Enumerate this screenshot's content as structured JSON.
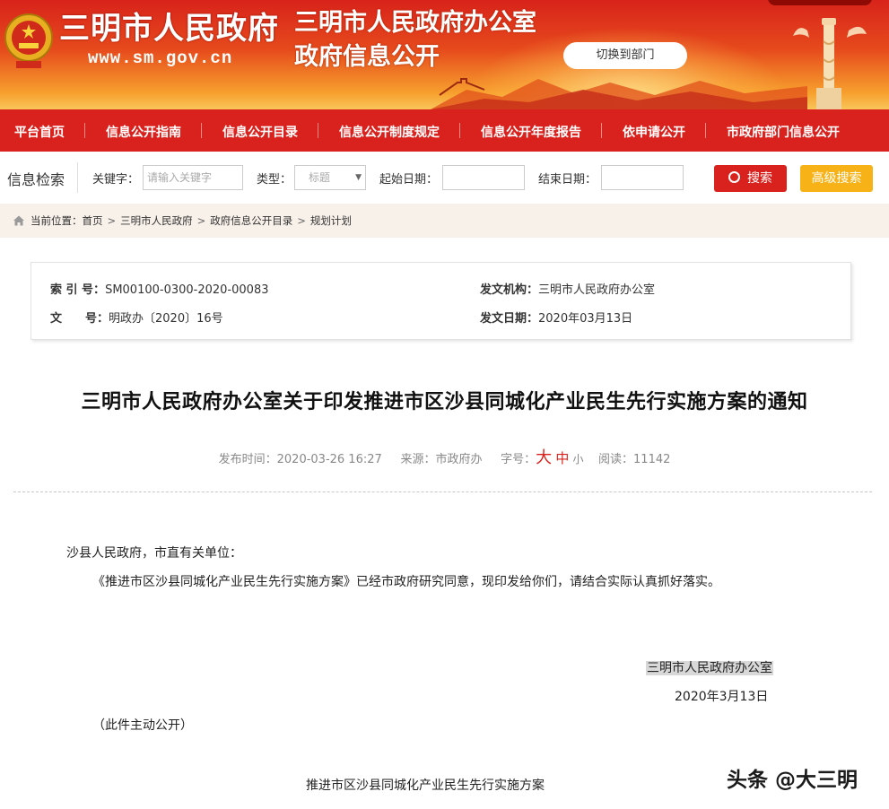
{
  "banner": {
    "site_name": "三明市人民政府",
    "site_url": "www.sm.gov.cn",
    "office_title": "三明市人民政府办公室",
    "office_subtitle": "政府信息公开",
    "switch_button": "切换到部门"
  },
  "nav": {
    "items": [
      "平台首页",
      "信息公开指南",
      "信息公开目录",
      "信息公开制度规定",
      "信息公开年度报告",
      "依申请公开",
      "市政府部门信息公开"
    ]
  },
  "search": {
    "title": "信息检索",
    "keyword_label": "关键字：",
    "keyword_placeholder": "请输入关键字",
    "type_label": "类型：",
    "type_value": "标题",
    "start_label": "起始日期：",
    "end_label": "结束日期：",
    "search_button": "搜索",
    "advanced_button": "高级搜索"
  },
  "breadcrumb": {
    "prefix": "当前位置：",
    "items": [
      "首页",
      "三明市人民政府",
      "政府信息公开目录",
      "规划计划"
    ]
  },
  "meta": {
    "index_label": "索 引 号：",
    "index_value": "SM00100-0300-2020-00083",
    "issuer_label": "发文机构：",
    "issuer_value": "三明市人民政府办公室",
    "docno_label": "文　　号：",
    "docno_value": "明政办〔2020〕16号",
    "date_label": "发文日期：",
    "date_value": "2020年03月13日"
  },
  "document": {
    "title": "三明市人民政府办公室关于印发推进市区沙县同城化产业民生先行实施方案的通知",
    "publish_label": "发布时间：",
    "publish_time": "2020-03-26 16:27",
    "source_label": "来源：",
    "source_value": "市政府办",
    "fontsize_label": "字号：",
    "fontsize_big": "大",
    "fontsize_mid": "中",
    "fontsize_small": "小",
    "views_label": "阅读：",
    "views_value": "11142",
    "salutation": "沙县人民政府，市直有关单位：",
    "paragraph": "《推进市区沙县同城化产业民生先行实施方案》已经市政府研究同意，现印发给你们，请结合实际认真抓好落实。",
    "signature_office": "三明市人民政府办公室",
    "signature_date": "2020年3月13日",
    "disclosure_note": "（此件主动公开）",
    "attachment_title": "推进市区沙县同城化产业民生先行实施方案"
  },
  "watermark": "头条 @大三明",
  "colors": {
    "brand_red": "#d9221d",
    "search_button": "#d9221d",
    "advanced_button": "#f7b217",
    "breadcrumb_bg": "#f8f1ea"
  }
}
